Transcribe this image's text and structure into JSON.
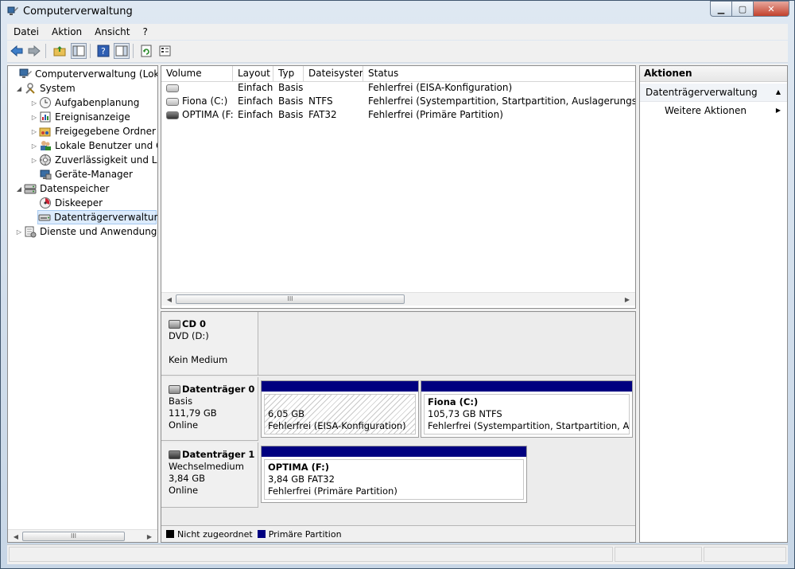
{
  "window": {
    "title": "Computerverwaltung"
  },
  "menu": [
    "Datei",
    "Aktion",
    "Ansicht",
    "?"
  ],
  "tree": [
    {
      "label": "Computerverwaltung (Lokal)",
      "icon": "computer-management-icon",
      "level": 0,
      "expander": ""
    },
    {
      "label": "System",
      "icon": "tools-icon",
      "level": 1,
      "expander": "◢"
    },
    {
      "label": "Aufgabenplanung",
      "icon": "clock-icon",
      "level": 2,
      "expander": "▷"
    },
    {
      "label": "Ereignisanzeige",
      "icon": "event-viewer-icon",
      "level": 2,
      "expander": "▷"
    },
    {
      "label": "Freigegebene Ordner",
      "icon": "shared-folder-icon",
      "level": 2,
      "expander": "▷"
    },
    {
      "label": "Lokale Benutzer und Gr",
      "icon": "users-icon",
      "level": 2,
      "expander": "▷"
    },
    {
      "label": "Zuverlässigkeit und Leis",
      "icon": "performance-icon",
      "level": 2,
      "expander": "▷"
    },
    {
      "label": "Geräte-Manager",
      "icon": "device-manager-icon",
      "level": 2,
      "expander": ""
    },
    {
      "label": "Datenspeicher",
      "icon": "storage-icon",
      "level": 1,
      "expander": "◢"
    },
    {
      "label": "Diskeeper",
      "icon": "diskeeper-icon",
      "level": 2,
      "expander": ""
    },
    {
      "label": "Datenträgerverwaltung",
      "icon": "disk-management-icon",
      "level": 2,
      "expander": "",
      "selected": true
    },
    {
      "label": "Dienste und Anwendungen",
      "icon": "services-icon",
      "level": 1,
      "expander": "▷"
    }
  ],
  "volumes": {
    "columns": [
      "Volume",
      "Layout",
      "Typ",
      "Dateisystem",
      "Status"
    ],
    "rows": [
      {
        "volume": "",
        "layout": "Einfach",
        "typ": "Basis",
        "fs": "",
        "status": "Fehlerfrei (EISA-Konfiguration)",
        "removable": false
      },
      {
        "volume": "Fiona (C:)",
        "layout": "Einfach",
        "typ": "Basis",
        "fs": "NTFS",
        "status": "Fehlerfrei (Systempartition, Startpartition, Auslagerungsdatei, Ab",
        "removable": false
      },
      {
        "volume": "OPTIMA (F:)",
        "layout": "Einfach",
        "typ": "Basis",
        "fs": "FAT32",
        "status": "Fehlerfrei (Primäre Partition)",
        "removable": true
      }
    ]
  },
  "disks": [
    {
      "name": "CD 0",
      "lines": [
        "DVD (D:)",
        "",
        "Kein Medium"
      ]
    },
    {
      "name": "Datenträger 0",
      "lines": [
        "Basis",
        "111,79 GB",
        "Online"
      ]
    },
    {
      "name": "Datenträger 1",
      "lines": [
        "Wechselmedium",
        "3,84 GB",
        "Online"
      ]
    }
  ],
  "partitions": {
    "disk0_p1": {
      "name": "",
      "size": "6,05 GB",
      "status": "Fehlerfrei (EISA-Konfiguration)"
    },
    "disk0_p2": {
      "name": "Fiona  (C:)",
      "size": "105,73 GB NTFS",
      "status": "Fehlerfrei (Systempartition, Startpartition, Auslag"
    },
    "disk1_p1": {
      "name": "OPTIMA  (F:)",
      "size": "3,84 GB FAT32",
      "status": "Fehlerfrei (Primäre Partition)"
    }
  },
  "legend": [
    {
      "label": "Nicht zugeordnet",
      "color": "#000000"
    },
    {
      "label": "Primäre Partition",
      "color": "#000080"
    }
  ],
  "actions": {
    "header": "Aktionen",
    "section": "Datenträgerverwaltung",
    "item": "Weitere Aktionen"
  },
  "scroll_glyph": "III"
}
